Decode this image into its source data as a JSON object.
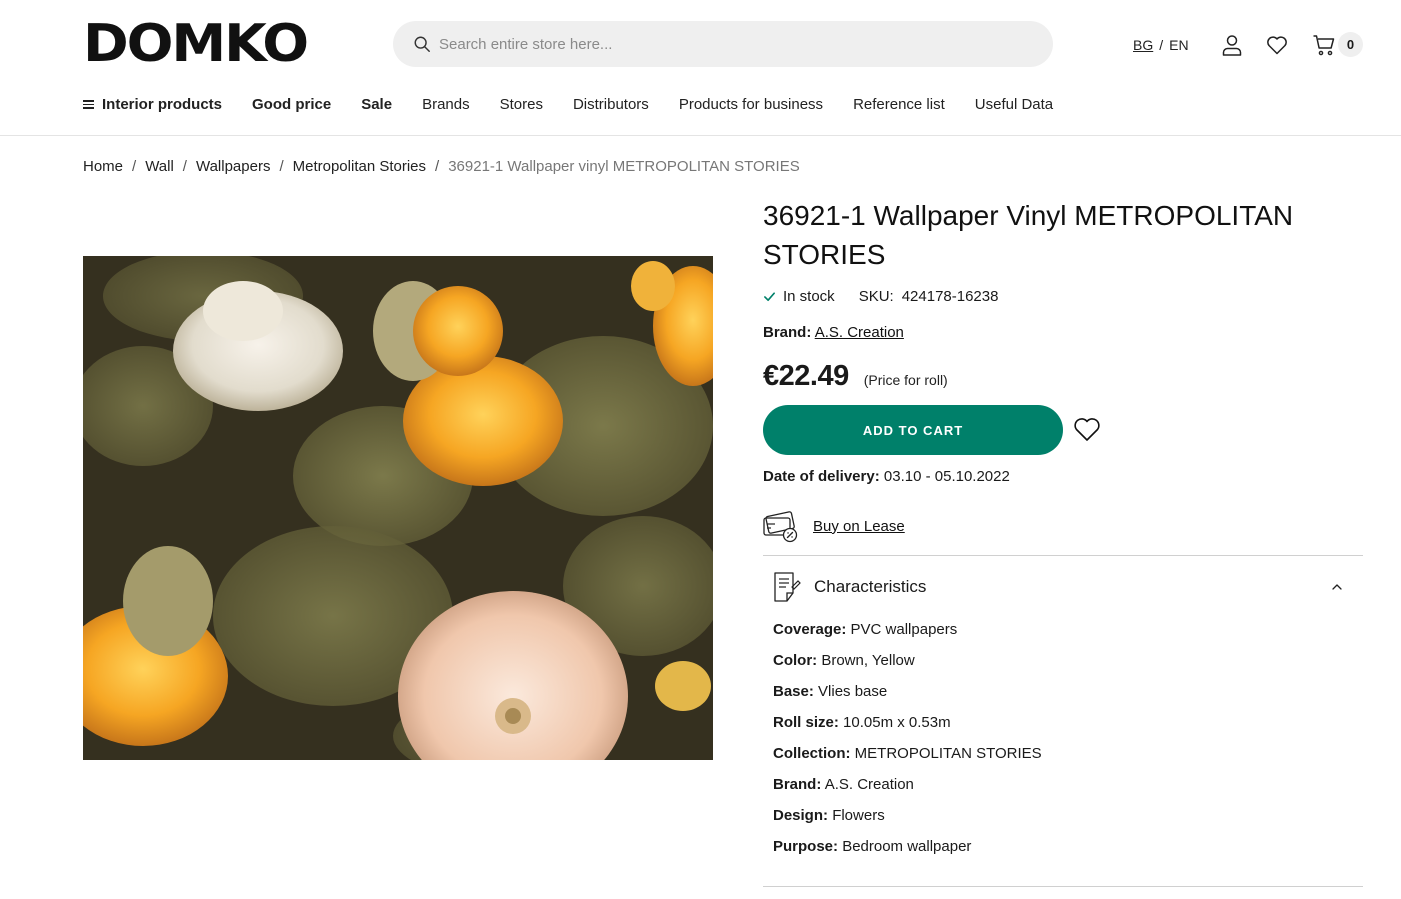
{
  "header": {
    "logo": "DOMKO",
    "search_placeholder": "Search entire store here...",
    "lang_bg": "BG",
    "lang_sep": "/",
    "lang_en": "EN",
    "cart_count": "0"
  },
  "nav": {
    "items": [
      {
        "label": "Interior products"
      },
      {
        "label": "Good price"
      },
      {
        "label": "Sale"
      },
      {
        "label": "Brands"
      },
      {
        "label": "Stores"
      },
      {
        "label": "Distributors"
      },
      {
        "label": "Products for business"
      },
      {
        "label": "Reference list"
      },
      {
        "label": "Useful Data"
      }
    ]
  },
  "breadcrumb": {
    "items": [
      "Home",
      "Wall",
      "Wallpapers",
      "Metropolitan Stories"
    ],
    "separator": "/",
    "current": "36921-1 Wallpaper vinyl METROPOLITAN STORIES"
  },
  "product": {
    "title": "36921-1 Wallpaper Vinyl METROPOLITAN STORIES",
    "stock": "In stock",
    "sku_label": "SKU:",
    "sku": "424178-16238",
    "brand_label": "Brand:",
    "brand": "A.S. Creation",
    "price": "€22.49",
    "price_note": "(Price for roll)",
    "add_to_cart": "ADD TO CART",
    "delivery_label": "Date of delivery:",
    "delivery_dates": "03.10 - 05.10.2022",
    "lease": "Buy on Lease"
  },
  "characteristics": {
    "title": "Characteristics",
    "rows": [
      {
        "label": "Coverage:",
        "value": "PVC wallpapers"
      },
      {
        "label": "Color:",
        "value": "Brown, Yellow"
      },
      {
        "label": "Base:",
        "value": "Vlies base"
      },
      {
        "label": "Roll size:",
        "value": "10.05m x 0.53m"
      },
      {
        "label": "Collection:",
        "value": "METROPOLITAN STORIES"
      },
      {
        "label": "Brand:",
        "value": "A.S. Creation"
      },
      {
        "label": "Design:",
        "value": "Flowers"
      },
      {
        "label": "Purpose:",
        "value": "Bedroom wallpaper"
      }
    ]
  },
  "colors": {
    "accent": "#00806a",
    "text": "#1a1a1a",
    "search_bg": "#efefef"
  },
  "icons": [
    "search-icon",
    "user-icon",
    "heart-icon",
    "cart-icon",
    "checkmark-icon",
    "lease-card-icon",
    "document-icon",
    "chevron-up-icon"
  ]
}
